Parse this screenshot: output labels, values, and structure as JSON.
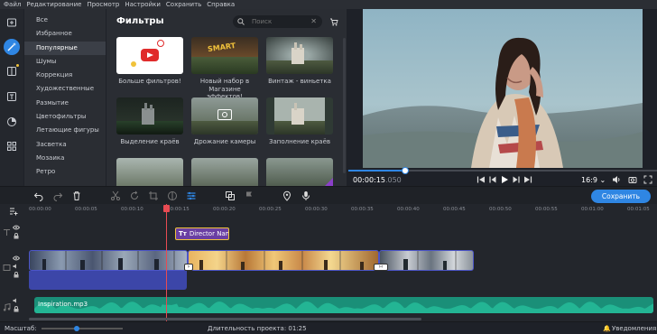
{
  "menu": [
    "Файл",
    "Редактирование",
    "Просмотр",
    "Настройки",
    "Сохранить",
    "Справка"
  ],
  "left_toolbar": [
    "import-icon",
    "filters-icon",
    "transitions-icon",
    "titles-icon",
    "stickers-icon",
    "more-tools-icon"
  ],
  "categories": [
    {
      "label": "Все"
    },
    {
      "label": "Избранное"
    },
    {
      "label": "Популярные",
      "selected": true
    },
    {
      "label": "Шумы"
    },
    {
      "label": "Коррекция"
    },
    {
      "label": "Художественные"
    },
    {
      "label": "Размытие"
    },
    {
      "label": "Цветофильтры"
    },
    {
      "label": "Летающие фигуры"
    },
    {
      "label": "Засветка"
    },
    {
      "label": "Мозаика"
    },
    {
      "label": "Ретро"
    }
  ],
  "filters": {
    "title": "Фильтры",
    "search_placeholder": "Поиск",
    "tiles": [
      {
        "label": "Больше фильтров!"
      },
      {
        "label": "Новый набор в Магазине эффектов!",
        "badge": "SMART"
      },
      {
        "label": "Винтаж - виньетка"
      },
      {
        "label": "Выделение краёв"
      },
      {
        "label": "Дрожание камеры"
      },
      {
        "label": "Заполнение краёв"
      }
    ]
  },
  "preview": {
    "time": "00:00:15",
    "time_ms": ".050",
    "ratio": "16:9 ⌄"
  },
  "toolbar": {
    "save_label": "Сохранить"
  },
  "timeline": {
    "ruler": [
      "00:00:00",
      "00:00:05",
      "00:00:10",
      "00:00:15",
      "00:00:20",
      "00:00:25",
      "00:00:30",
      "00:00:35",
      "00:00:40",
      "00:00:45",
      "00:00:50",
      "00:00:55",
      "00:01:00",
      "00:01:05"
    ],
    "text_clip": "Director Nam",
    "audio_clip": "Inspiration.mp3"
  },
  "status": {
    "zoom_label": "Масштаб:",
    "duration": "Длительность проекта: 01:25",
    "notifications": "Уведомления"
  },
  "colors": {
    "accent": "#2f86e3",
    "playhead": "#e84b53",
    "audio": "#1a8f78",
    "text_clip": "#6a3fa3"
  }
}
